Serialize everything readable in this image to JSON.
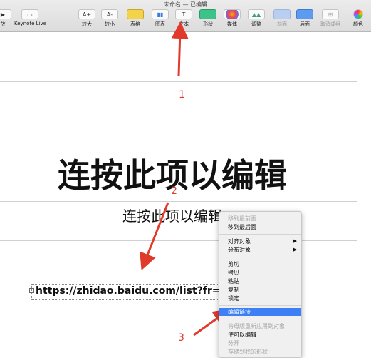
{
  "window": {
    "title": "未命名 — 已编辑"
  },
  "toolbar": {
    "play": "放",
    "keynote_live": "Keynote Live",
    "bigger": "较大",
    "smaller": "较小",
    "table": "表格",
    "chart": "图表",
    "text": "文本",
    "shape": "形状",
    "media": "媒体",
    "adjust": "调整",
    "front": "前面",
    "back": "后面",
    "ungroup": "取消成组",
    "color": "颜色",
    "bigger_icon_text": "A+",
    "smaller_icon_text": "A-",
    "text_icon_text": "T"
  },
  "slide": {
    "title": "连按此项以编辑",
    "subtitle": "连按此项以编辑",
    "link": "https://zhidao.baidu.com/list?fr=daohang"
  },
  "annotations": {
    "n1": "1",
    "n2": "2",
    "n3": "3"
  },
  "context_menu": {
    "bring_to_front": "移到最前面",
    "send_to_back": "移到最后面",
    "align": "对齐对象",
    "distribute": "分布对象",
    "cut": "剪切",
    "copy": "拷贝",
    "paste": "粘贴",
    "duplicate": "复制",
    "lock": "锁定",
    "edit_link": "编辑链接",
    "apply_master": "将母版重新应用到对象",
    "editable": "使可以编辑",
    "separate": "分开",
    "save_shape": "存储到我的形状",
    "submenu_arrow": "▶"
  },
  "colors": {
    "annotation": "#e03a2a",
    "highlight": "#3d7ff5"
  }
}
